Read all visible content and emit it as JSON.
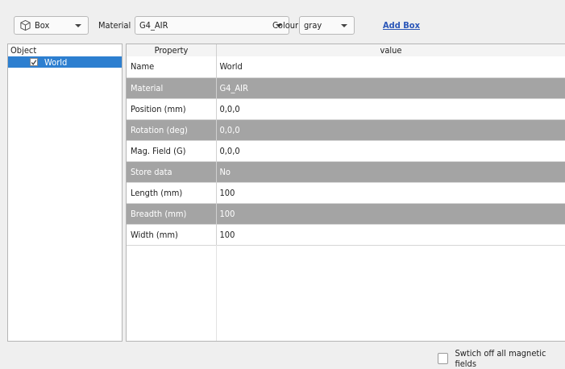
{
  "toolbar": {
    "shape": {
      "value": "Box",
      "icon": "cube-icon"
    },
    "material_label": "Material",
    "material": {
      "value": "G4_AIR"
    },
    "colour_label": "Colour",
    "colour": {
      "value": "gray"
    },
    "add_button": "Add Box"
  },
  "tree": {
    "header": "Object",
    "items": [
      {
        "label": "World",
        "checked": true
      }
    ]
  },
  "properties": {
    "headers": {
      "property": "Property",
      "value": "value"
    },
    "rows": [
      {
        "key": "Name",
        "value": "World"
      },
      {
        "key": "Material",
        "value": "G4_AIR"
      },
      {
        "key": "Position (mm)",
        "value": "0,0,0"
      },
      {
        "key": "Rotation  (deg)",
        "value": "0,0,0"
      },
      {
        "key": "Mag. Field  (G)",
        "value": "0,0,0"
      },
      {
        "key": "Store data",
        "value": "No"
      },
      {
        "key": "Length (mm)",
        "value": "100"
      },
      {
        "key": "Breadth (mm)",
        "value": "100"
      },
      {
        "key": "Width (mm)",
        "value": "100"
      }
    ]
  },
  "footer": {
    "magnetic_toggle": {
      "label": "Swtich off all magnetic fields",
      "checked": false
    }
  }
}
